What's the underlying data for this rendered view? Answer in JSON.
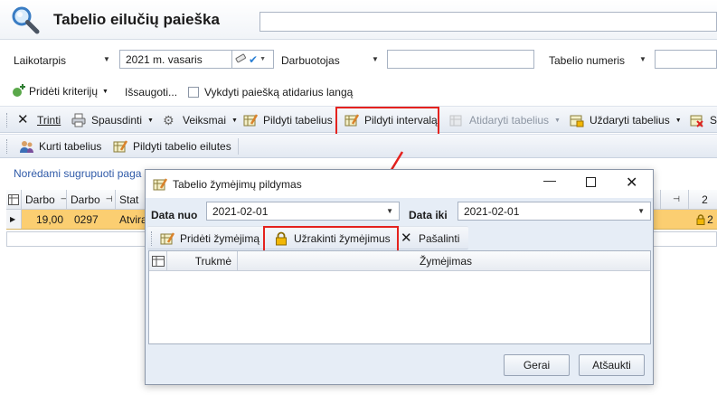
{
  "header": {
    "title": "Tabelio eilučių paieška",
    "search_value": ""
  },
  "filters": {
    "laikotarpis_label": "Laikotarpis",
    "laikotarpis_value": "2021 m. vasaris",
    "darbuotojas_label": "Darbuotojas",
    "darbuotojas_value": "",
    "tabelio_numeris_label": "Tabelio numeris",
    "tabelio_numeris_value": ""
  },
  "criteria": {
    "add_criteria": "Pridėti kriterijų",
    "save": "Išsaugoti...",
    "checkbox_label": "Vykdyti paiešką atidarius langą"
  },
  "toolbar1": {
    "delete": "Trinti",
    "print": "Spausdinti",
    "actions": "Veiksmai",
    "fill_tables": "Pildyti tabelius",
    "fill_interval": "Pildyti intervalą",
    "open_tables": "Atidaryti tabelius",
    "close_tables": "Uždaryti tabelius",
    "truncated": "S"
  },
  "toolbar2": {
    "create_tables": "Kurti tabelius",
    "fill_rows": "Pildyti tabelio eilutes"
  },
  "group_hint": "Norėdami sugrupuoti paga",
  "grid": {
    "columns": [
      "Darbo",
      "Darbo",
      "Stat"
    ],
    "right_col_header": "2",
    "row": {
      "c1": "19,00",
      "c2": "0297",
      "c3": "Atvira",
      "right_val": "2"
    }
  },
  "dialog": {
    "title": "Tabelio žymėjimų pildymas",
    "data_nuo_label": "Data nuo",
    "data_nuo_value": "2021-02-01",
    "data_iki_label": "Data iki",
    "data_iki_value": "2021-02-01",
    "toolbar": {
      "add_mark": "Pridėti žymėjimą",
      "lock_marks": "Užrakinti žymėjimus",
      "remove": "Pašalinti"
    },
    "columns": {
      "duration": "Trukmė",
      "mark": "Žymėjimas"
    },
    "ok": "Gerai",
    "cancel": "Atšaukti"
  },
  "colors": {
    "highlight": "#e4221e",
    "selected_row": "#fbce71",
    "lock": "#f2b705"
  }
}
